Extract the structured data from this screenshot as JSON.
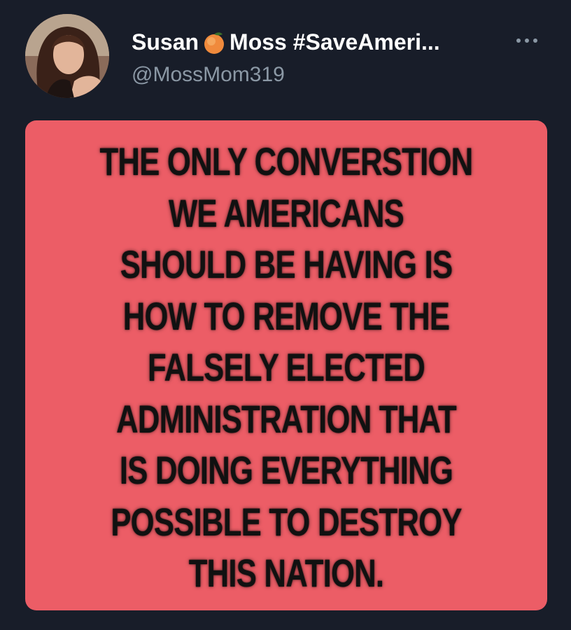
{
  "author": {
    "display_name_part1": "Susan",
    "peach_icon": "peach-emoji-icon",
    "display_name_part2": "Moss #SaveAmeri...",
    "handle": "@MossMom319"
  },
  "menu": {
    "icon": "more-options-icon"
  },
  "image_text": {
    "lines": [
      "THE ONLY CONVERSTION",
      "WE AMERICANS",
      "SHOULD BE HAVING IS",
      "HOW TO REMOVE THE",
      "FALSELY ELECTED",
      "ADMINISTRATION THAT",
      "IS DOING EVERYTHING",
      "POSSIBLE TO DESTROY",
      "THIS NATION."
    ]
  },
  "colors": {
    "background": "#181d29",
    "card": "#ec5d66",
    "text_primary": "#ffffff",
    "text_secondary": "#8b98a5"
  }
}
